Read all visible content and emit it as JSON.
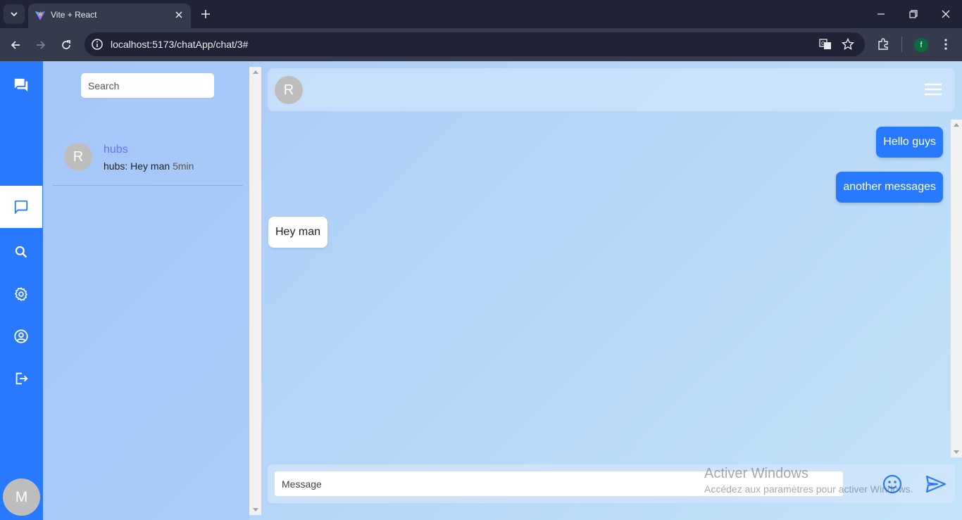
{
  "browser": {
    "tab_title": "Vite + React",
    "url": "localhost:5173/chatApp/chat/3#",
    "profile_initial": "f"
  },
  "sidebar": {
    "items": [
      {
        "icon": "forum-icon"
      },
      {
        "icon": "chat-icon",
        "active": true
      },
      {
        "icon": "search-icon"
      },
      {
        "icon": "gear-icon"
      },
      {
        "icon": "account-circle-icon"
      },
      {
        "icon": "logout-icon"
      }
    ],
    "user_initial": "M",
    "accent": "#2979ff"
  },
  "conversations": {
    "search_placeholder": "Search",
    "items": [
      {
        "initial": "R",
        "name": "hubs",
        "preview": "hubs: Hey man",
        "time": "5min"
      }
    ]
  },
  "chat": {
    "header_initial": "R",
    "messages": [
      {
        "text": "Hello guys",
        "direction": "outgoing"
      },
      {
        "text": "another messages",
        "direction": "outgoing"
      },
      {
        "text": "Hey man",
        "direction": "incoming"
      }
    ],
    "input_placeholder": "Message"
  },
  "watermark": {
    "title": "Activer Windows",
    "subtitle": "Accédez aux paramètres pour activer Windows."
  }
}
